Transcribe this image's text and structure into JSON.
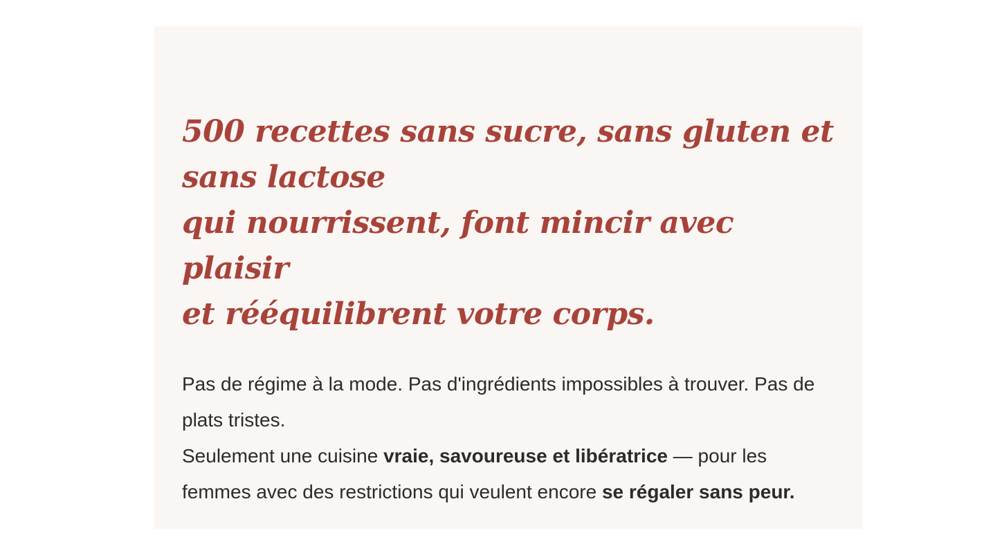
{
  "headline": {
    "line1": "500 recettes sans sucre, sans gluten et sans lactose",
    "line2": "qui nourrissent, font mincir avec plaisir",
    "line3": "et rééquilibrent votre corps."
  },
  "intro": {
    "paragraph1": "Pas de régime à la mode. Pas d'ingrédients impossibles à trouver. Pas de plats tristes.",
    "p2_part1": "Seulement une cuisine ",
    "p2_bold1": "vraie, savoureuse et libératrice",
    "p2_part2": " — pour les femmes avec des restrictions qui veulent encore ",
    "p2_bold2": "se régaler sans peur."
  },
  "colors": {
    "accent": "#a8433a",
    "card_background": "#faf6f4",
    "text": "#2b2b2b"
  }
}
